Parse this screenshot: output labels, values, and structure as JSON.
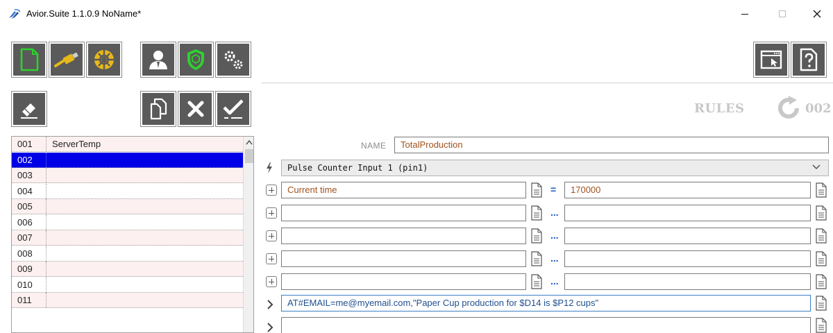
{
  "window": {
    "title": "Avior.Suite 1.1.0.9  NoName*",
    "minimize_glyph": "—",
    "maximize_glyph": "☐",
    "close_glyph": "✕"
  },
  "toolbar": {
    "left_icons": [
      "new-file-icon",
      "usb-plug-icon",
      "network-globe-icon",
      "user-icon",
      "shield-icon",
      "gears-icon"
    ],
    "right_icons": [
      "window-cursor-icon",
      "help-document-icon"
    ],
    "accent_colors": {
      "green": "#2ed12e",
      "yellow": "#e8b81a",
      "button_bg": "#5a5a5a"
    }
  },
  "rules_toolbar": {
    "icons": [
      "eraser-icon",
      "copy-icon",
      "delete-icon",
      "accept-icon"
    ]
  },
  "rules_header": {
    "label": "RULES",
    "number": "002"
  },
  "rule_list": {
    "selected": "002",
    "rows": [
      {
        "num": "001",
        "name": "ServerTemp"
      },
      {
        "num": "002",
        "name": ""
      },
      {
        "num": "003",
        "name": ""
      },
      {
        "num": "004",
        "name": ""
      },
      {
        "num": "005",
        "name": ""
      },
      {
        "num": "006",
        "name": ""
      },
      {
        "num": "007",
        "name": ""
      },
      {
        "num": "008",
        "name": ""
      },
      {
        "num": "009",
        "name": ""
      },
      {
        "num": "010",
        "name": ""
      },
      {
        "num": "011",
        "name": ""
      }
    ]
  },
  "form": {
    "name_label": "NAME",
    "name_value": "TotalProduction",
    "trigger": "Pulse Counter Input 1 (pin1)",
    "conditions": [
      {
        "left": "Current time",
        "operator": "=",
        "right": "170000"
      },
      {
        "left": "",
        "operator": "...",
        "right": ""
      },
      {
        "left": "",
        "operator": "...",
        "right": ""
      },
      {
        "left": "",
        "operator": "...",
        "right": ""
      },
      {
        "left": "",
        "operator": "...",
        "right": ""
      }
    ],
    "actions": [
      "AT#EMAIL=me@myemail.com,\"Paper Cup production for $D14 is $P12 cups\"",
      ""
    ]
  }
}
